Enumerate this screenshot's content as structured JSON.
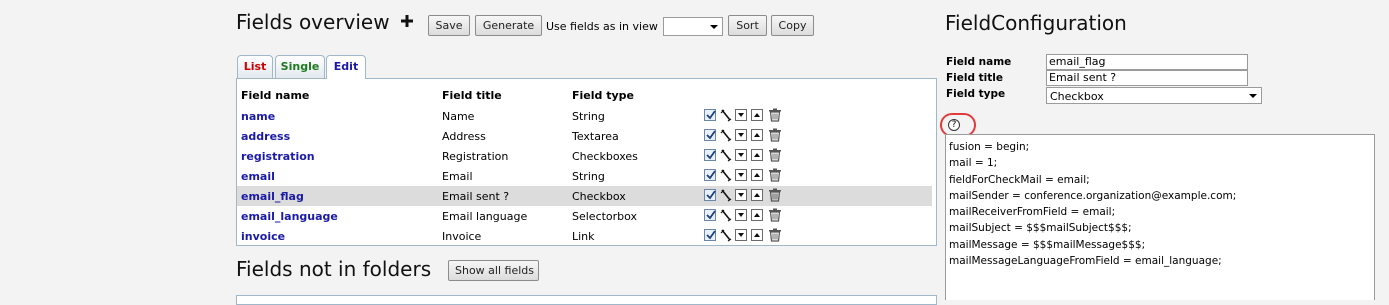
{
  "overview": {
    "title": "Fields overview",
    "add_icon": "plus-icon",
    "save_label": "Save",
    "generate_label": "Generate",
    "use_fields_label": "Use fields as in view",
    "view_select_value": "",
    "sort_label": "Sort",
    "copy_label": "Copy"
  },
  "tabs": [
    {
      "label": "List",
      "color": "#cc0000"
    },
    {
      "label": "Single",
      "color": "#1e7a1e"
    },
    {
      "label": "Edit",
      "color": "#1a1aa6"
    }
  ],
  "table": {
    "headers": [
      "Field name",
      "Field title",
      "Field type"
    ],
    "rows": [
      {
        "name": "name",
        "title": "Name",
        "type": "String",
        "selected": false
      },
      {
        "name": "address",
        "title": "Address",
        "type": "Textarea",
        "selected": false
      },
      {
        "name": "registration",
        "title": "Registration",
        "type": "Checkboxes",
        "selected": false
      },
      {
        "name": "email",
        "title": "Email",
        "type": "String",
        "selected": false
      },
      {
        "name": "email_flag",
        "title": "Email sent ?",
        "type": "Checkbox",
        "selected": true
      },
      {
        "name": "email_language",
        "title": "Email language",
        "type": "Selectorbox",
        "selected": false
      },
      {
        "name": "invoice",
        "title": "Invoice",
        "type": "Link",
        "selected": false
      }
    ],
    "row_icons": [
      "checkbox-icon",
      "edit-pen-icon",
      "move-down-icon",
      "move-up-icon",
      "trash-icon"
    ]
  },
  "not_in_folders": {
    "title": "Fields not in folders",
    "show_all_label": "Show all fields"
  },
  "config": {
    "title": "FieldConfiguration",
    "field_name_label": "Field name",
    "field_name_value": "email_flag",
    "field_title_label": "Field title",
    "field_title_value": "Email sent ?",
    "field_type_label": "Field type",
    "field_type_value": "Checkbox",
    "help_icon": "?",
    "code_lines": [
      "fusion = begin;",
      "mail = 1;",
      "fieldForCheckMail = email;",
      "mailSender = conference.organization@example.com;",
      "mailReceiverFromField = email;",
      "mailSubject = $$$mailSubject$$$;",
      "mailMessage = $$$mailMessage$$$;",
      "mailMessageLanguageFromField = email_language;"
    ]
  },
  "colors": {
    "highlight_circle": "#e23b3b",
    "field_name_link": "#1a1aa6",
    "selected_row": "#dcdcdc"
  }
}
